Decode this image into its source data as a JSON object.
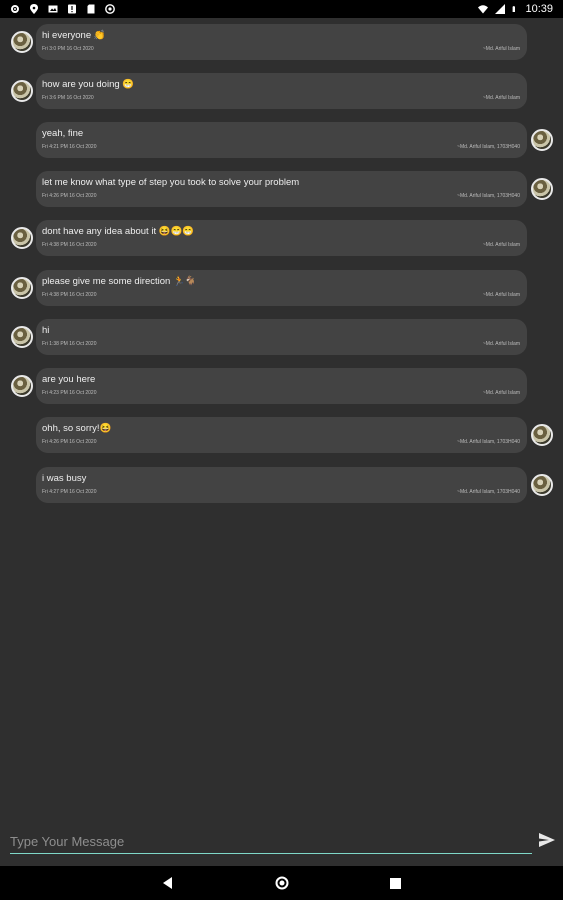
{
  "status_bar": {
    "time": "10:39",
    "left_icons": [
      "gear-icon",
      "location-icon",
      "image-icon",
      "alert-icon",
      "sd-card-icon",
      "cast-icon"
    ],
    "right_icons": [
      "wifi-icon",
      "signal-icon",
      "battery-icon"
    ]
  },
  "messages": [
    {
      "side": "left",
      "text": "hi everyone 👏",
      "time": "Fri 3:0 PM 16 Oct 2020",
      "author": "~Md. Ariful Islam"
    },
    {
      "side": "left",
      "text": "how are you doing 😁",
      "time": "Fri 3:6 PM 16 Oct 2020",
      "author": "~Md. Ariful Islam"
    },
    {
      "side": "right",
      "text": "yeah, fine",
      "time": "Fri 4:21 PM 16 Oct 2020",
      "author": "~Md. Ariful Islam, 1703H040"
    },
    {
      "side": "right",
      "text": "let me know what type of step you took to solve your problem",
      "time": "Fri 4:26 PM 16 Oct 2020",
      "author": "~Md. Ariful Islam, 1703H040"
    },
    {
      "side": "left",
      "text": " dont have any idea about it 😆😁😁",
      "time": "Fri 4:38 PM 16 Oct 2020",
      "author": "~Md. Ariful Islam"
    },
    {
      "side": "left",
      "text": "please give me some direction 🏃🐐",
      "time": "Fri 4:38 PM 16 Oct 2020",
      "author": "~Md. Ariful Islam"
    },
    {
      "side": "left",
      "text": "hi",
      "time": "Fri 1:38 PM 16 Oct 2020",
      "author": "~Md. Ariful Islam"
    },
    {
      "side": "left",
      "text": "are you here",
      "time": "Fri 4:23 PM 16 Oct 2020",
      "author": "~Md. Ariful Islam"
    },
    {
      "side": "right",
      "text": "ohh, so sorry!😆",
      "time": "Fri 4:26 PM 16 Oct 2020",
      "author": "~Md. Ariful Islam, 1703H040"
    },
    {
      "side": "right",
      "text": "i was busy",
      "time": "Fri 4:27 PM 16 Oct 2020",
      "author": "~Md. Ariful Islam, 1703H040"
    }
  ],
  "composer": {
    "placeholder": "Type Your Message",
    "value": "",
    "send_icon": "send-icon",
    "accent": "#7fd8c8"
  },
  "nav_bar": {
    "buttons": [
      "back-icon",
      "home-icon",
      "recents-icon"
    ]
  }
}
